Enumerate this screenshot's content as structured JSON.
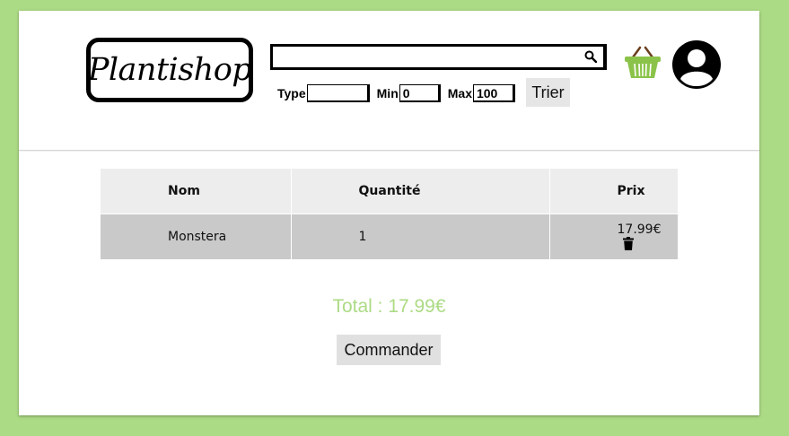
{
  "header": {
    "logo_text": "Plantishop",
    "search": {
      "value": "",
      "placeholder": ""
    },
    "filters": {
      "type_label": "Type",
      "type_value": "",
      "min_label": "Min",
      "min_value": "0",
      "max_label": "Max",
      "max_value": "100"
    },
    "sort_button": "Trier",
    "icons": {
      "search": "search-icon",
      "basket": "basket-icon",
      "account": "account-icon"
    }
  },
  "cart": {
    "columns": [
      "Nom",
      "Quantité",
      "Prix"
    ],
    "rows": [
      {
        "name": "Monstera",
        "quantity": "1",
        "price": "17.99€"
      }
    ]
  },
  "total_text": "Total : 17.99€",
  "order_button": "Commander",
  "colors": {
    "background": "#acdb85",
    "accent": "#acdb85",
    "header_row": "#ededed",
    "body_row": "#c9c9c9"
  }
}
